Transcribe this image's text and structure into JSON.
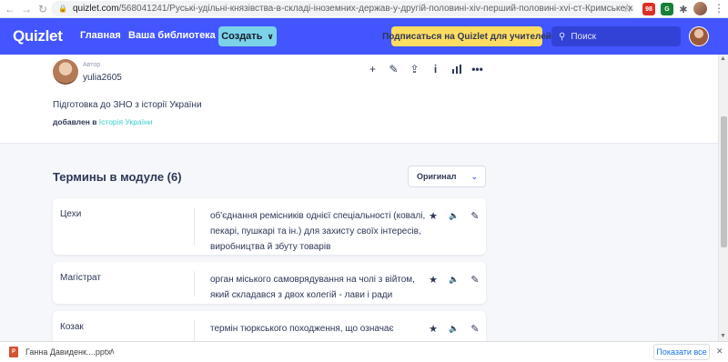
{
  "browser": {
    "url_host": "quizlet.com",
    "url_path": "/568041241/Руські-удільні-князівства-в-складі-іноземних-держав-у-другій-половині-xiv-перший-половині-xvi-ст-Кримське-ханство-flash-cards/",
    "extensions": [
      {
        "name": "extension-1",
        "text": "98",
        "color": "#d93025"
      },
      {
        "name": "extension-2",
        "text": "G",
        "color": "#188038"
      },
      {
        "name": "extension-3",
        "text": "●",
        "color": "#f9ab00"
      }
    ]
  },
  "header": {
    "logo": "Quizlet",
    "nav_home": "Главная",
    "nav_library": "Ваша библиотека",
    "create": "Создать",
    "teacher_cta": "Подписаться на Quizlet для учителей",
    "search_placeholder": "Поиск"
  },
  "set": {
    "author_label": "Автор",
    "author_name": "yulia2605",
    "description": "Підготовка до ЗНО з історії України",
    "added_prefix": "добавлен в",
    "added_folder": "Історія України"
  },
  "terms_section": {
    "title": "Термины в модуле (6)",
    "sort_option": "Оригинал"
  },
  "terms": [
    {
      "term": "Цехи",
      "definition": "об'єднання ремісників однієї спеціальності (ковалі, пекарі, пушкарі та ін.) для захисту своїх інтересів, виробництва й збуту товарів"
    },
    {
      "term": "Магістрат",
      "definition": "орган міського самоврядування на чолі з війтом, який складався з двох колегій - лави і ради"
    },
    {
      "term": "Козак",
      "definition": "термін тюркського походження, що означає"
    }
  ],
  "downloads": {
    "file_name": "Ганна Давиденк....pptx",
    "show_all": "Показати все"
  }
}
